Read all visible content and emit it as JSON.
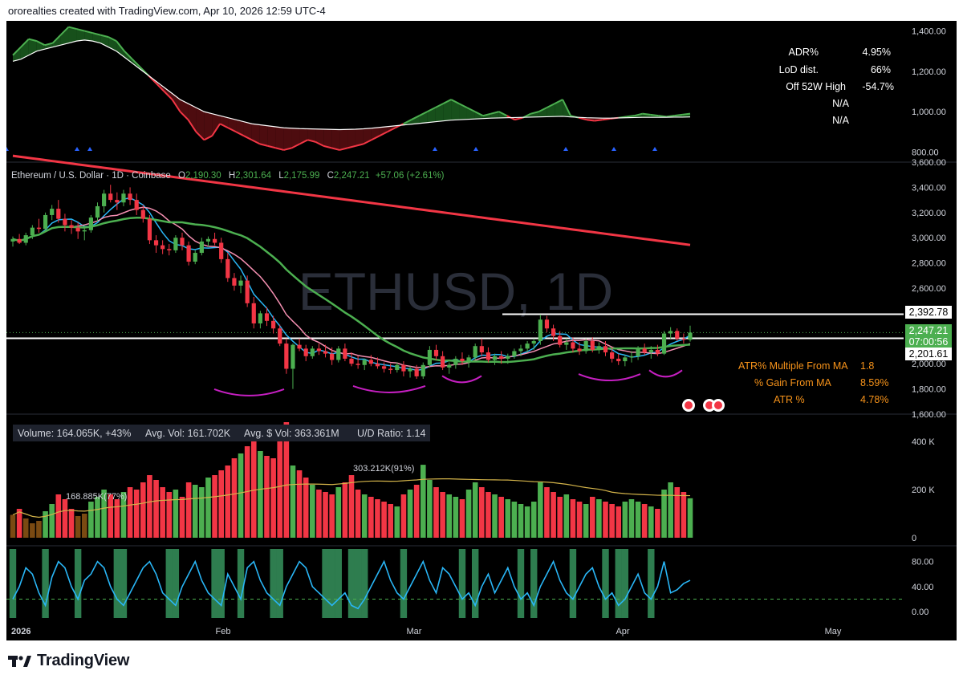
{
  "header": {
    "caption": "ororealties created with TradingView.com, Apr 10, 2026 12:59 UTC-4"
  },
  "branding": {
    "name": "TradingView",
    "icon": "tradingview-logo-icon"
  },
  "watermark": "ETHUSD, 1D",
  "colors": {
    "background": "#000000",
    "up": "#4caf50",
    "down": "#f23645",
    "ma_red": "#f23645",
    "ma_green": "#4caf50",
    "ma_pink": "#f48fb1",
    "ma_cyan": "#29b6f6",
    "stats_orange": "#f7931a",
    "rsi_line": "#29b6f6",
    "volume_ma": "#d4b44a",
    "highlight_green": "#2e7d4f"
  },
  "top_panel": {
    "stats": [
      {
        "label": "ADR%",
        "value": "4.95%"
      },
      {
        "label": "LoD dist.",
        "value": "66%"
      },
      {
        "label": "Off 52W High",
        "value": "-54.7%"
      },
      {
        "label": "",
        "value": "N/A"
      },
      {
        "label": "",
        "value": "N/A"
      }
    ],
    "y_ticks": [
      "1,400.00",
      "1,200.00",
      "1,000.00",
      "800.00"
    ]
  },
  "legend": {
    "symbol": "Ethereum / U.S. Dollar · 1D · Coinbase",
    "o_label": "O",
    "o": "2,190.30",
    "h_label": "H",
    "h": "2,301.64",
    "l_label": "L",
    "l": "2,175.99",
    "c_label": "C",
    "c": "2,247.21",
    "change": "+57.06 (+2.61%)"
  },
  "price_panel": {
    "y_ticks": [
      "3,600.00",
      "3,400.00",
      "3,200.00",
      "3,000.00",
      "2,800.00",
      "2,600.00",
      "2,400.00",
      "2,200.00",
      "2,000.00",
      "1,800.00",
      "1,600.00"
    ],
    "levels": [
      {
        "label": "2,392.78",
        "value": 2392.78,
        "style": "white"
      },
      {
        "label": "2,247.21",
        "value": 2247.21,
        "style": "green"
      },
      {
        "label": "07:00:56",
        "value": 2247.21,
        "style": "green-sub"
      },
      {
        "label": "2,201.61",
        "value": 2201.61,
        "style": "white"
      }
    ],
    "stats": [
      {
        "label": "ATR% Multiple From MA",
        "value": "1.8"
      },
      {
        "label": "% Gain From MA",
        "value": "8.59%"
      },
      {
        "label": "ATR %",
        "value": "4.78%"
      }
    ]
  },
  "volume_panel": {
    "legend": {
      "volume": "Volume: 164.065K, +43%",
      "avg_vol": "Avg. Vol: 161.702K",
      "dollar_vol": "Avg. $ Vol: 363.361M",
      "ud_ratio": "U/D Ratio: 1.14"
    },
    "y_ticks": [
      "400 K",
      "200 K",
      "0"
    ],
    "annotations": [
      {
        "text": "168.885K(77%)"
      },
      {
        "text": "303.212K(91%)"
      }
    ]
  },
  "osc_panel": {
    "y_ticks": [
      "80.00",
      "40.00",
      "0.00"
    ]
  },
  "x_axis": {
    "labels": [
      "2026",
      "Feb",
      "Mar",
      "Apr",
      "May"
    ]
  },
  "chart_data": {
    "type": "candlestick",
    "symbol": "ETHUSD",
    "interval": "1D",
    "x": [
      "2026",
      "Feb",
      "Mar",
      "Apr",
      "May"
    ],
    "price_ylim": [
      1600,
      3600
    ],
    "volume_ylim": [
      0,
      480000
    ],
    "osc_ylim": [
      -10,
      100
    ],
    "top_ylim": [
      750,
      1450
    ],
    "candles": [
      [
        2970,
        3010,
        2930,
        2990
      ],
      [
        2990,
        3030,
        2950,
        2960
      ],
      [
        2960,
        3040,
        2940,
        3020
      ],
      [
        3020,
        3100,
        2990,
        3080
      ],
      [
        3080,
        3150,
        3040,
        3070
      ],
      [
        3070,
        3200,
        3050,
        3180
      ],
      [
        3180,
        3260,
        3140,
        3230
      ],
      [
        3230,
        3300,
        3120,
        3150
      ],
      [
        3150,
        3190,
        3050,
        3100
      ],
      [
        3100,
        3140,
        3030,
        3080
      ],
      [
        3080,
        3120,
        2990,
        3050
      ],
      [
        3050,
        3100,
        2980,
        3060
      ],
      [
        3060,
        3180,
        3040,
        3160
      ],
      [
        3160,
        3280,
        3130,
        3250
      ],
      [
        3250,
        3380,
        3200,
        3350
      ],
      [
        3350,
        3420,
        3280,
        3300
      ],
      [
        3300,
        3360,
        3220,
        3280
      ],
      [
        3280,
        3380,
        3250,
        3350
      ],
      [
        3350,
        3400,
        3260,
        3300
      ],
      [
        3300,
        3350,
        3180,
        3220
      ],
      [
        3220,
        3260,
        3120,
        3150
      ],
      [
        3150,
        3180,
        2950,
        2980
      ],
      [
        2980,
        3020,
        2880,
        2940
      ],
      [
        2940,
        2980,
        2870,
        2910
      ],
      [
        2910,
        2950,
        2860,
        2900
      ],
      [
        2900,
        3020,
        2880,
        3000
      ],
      [
        3000,
        3040,
        2900,
        2940
      ],
      [
        2940,
        2970,
        2780,
        2810
      ],
      [
        2810,
        2900,
        2790,
        2880
      ],
      [
        2880,
        3000,
        2860,
        2970
      ],
      [
        2970,
        3010,
        2930,
        2990
      ],
      [
        2990,
        3040,
        2940,
        2960
      ],
      [
        2960,
        3000,
        2800,
        2830
      ],
      [
        2830,
        2880,
        2650,
        2680
      ],
      [
        2680,
        2720,
        2580,
        2620
      ],
      [
        2620,
        2700,
        2560,
        2660
      ],
      [
        2660,
        2700,
        2450,
        2480
      ],
      [
        2480,
        2530,
        2280,
        2320
      ],
      [
        2320,
        2420,
        2280,
        2400
      ],
      [
        2400,
        2450,
        2300,
        2340
      ],
      [
        2340,
        2380,
        2240,
        2280
      ],
      [
        2280,
        2310,
        2140,
        2160
      ],
      [
        2160,
        2200,
        1920,
        1960
      ],
      [
        1960,
        2160,
        1800,
        2150
      ],
      [
        2150,
        2200,
        2100,
        2120
      ],
      [
        2120,
        2150,
        2020,
        2060
      ],
      [
        2060,
        2140,
        2040,
        2120
      ],
      [
        2120,
        2160,
        2070,
        2100
      ],
      [
        2100,
        2150,
        2050,
        2080
      ],
      [
        2080,
        2130,
        1990,
        2030
      ],
      [
        2030,
        2140,
        2010,
        2120
      ],
      [
        2120,
        2160,
        2020,
        2040
      ],
      [
        2040,
        2090,
        1980,
        2000
      ],
      [
        2000,
        2060,
        1960,
        1990
      ],
      [
        1990,
        2040,
        1950,
        2030
      ],
      [
        2030,
        2070,
        1980,
        2000
      ],
      [
        2000,
        2050,
        1960,
        1980
      ],
      [
        1980,
        2010,
        1930,
        1960
      ],
      [
        1960,
        2000,
        1920,
        1950
      ],
      [
        1950,
        2010,
        1930,
        1990
      ],
      [
        1990,
        2020,
        1900,
        1940
      ],
      [
        1940,
        1980,
        1890,
        1960
      ],
      [
        1960,
        1990,
        1880,
        1900
      ],
      [
        1900,
        2010,
        1880,
        1990
      ],
      [
        1990,
        2140,
        1970,
        2110
      ],
      [
        2110,
        2150,
        2030,
        2060
      ],
      [
        2060,
        2100,
        1950,
        1970
      ],
      [
        1970,
        2010,
        1920,
        1990
      ],
      [
        1990,
        2060,
        1960,
        2040
      ],
      [
        2040,
        2090,
        1990,
        2020
      ],
      [
        2020,
        2070,
        1970,
        2050
      ],
      [
        2050,
        2160,
        2030,
        2140
      ],
      [
        2140,
        2200,
        2060,
        2090
      ],
      [
        2090,
        2130,
        2010,
        2030
      ],
      [
        2030,
        2080,
        1990,
        2060
      ],
      [
        2060,
        2100,
        2000,
        2040
      ],
      [
        2040,
        2080,
        2000,
        2060
      ],
      [
        2060,
        2120,
        2040,
        2100
      ],
      [
        2100,
        2150,
        2060,
        2120
      ],
      [
        2120,
        2180,
        2090,
        2160
      ],
      [
        2160,
        2200,
        2110,
        2180
      ],
      [
        2180,
        2390,
        2150,
        2350
      ],
      [
        2350,
        2380,
        2250,
        2280
      ],
      [
        2280,
        2310,
        2180,
        2220
      ],
      [
        2220,
        2260,
        2130,
        2150
      ],
      [
        2150,
        2200,
        2110,
        2170
      ],
      [
        2170,
        2210,
        2090,
        2120
      ],
      [
        2120,
        2170,
        2070,
        2100
      ],
      [
        2100,
        2200,
        2080,
        2180
      ],
      [
        2180,
        2210,
        2090,
        2110
      ],
      [
        2110,
        2170,
        2080,
        2140
      ],
      [
        2140,
        2180,
        2060,
        2090
      ],
      [
        2090,
        2130,
        2010,
        2040
      ],
      [
        2040,
        2080,
        1990,
        2020
      ],
      [
        2020,
        2070,
        1980,
        2050
      ],
      [
        2050,
        2100,
        2010,
        2060
      ],
      [
        2060,
        2140,
        2030,
        2120
      ],
      [
        2120,
        2160,
        2070,
        2090
      ],
      [
        2090,
        2140,
        2040,
        2110
      ],
      [
        2110,
        2150,
        2060,
        2080
      ],
      [
        2080,
        2260,
        2070,
        2240
      ],
      [
        2240,
        2290,
        2200,
        2260
      ],
      [
        2260,
        2280,
        2180,
        2200
      ],
      [
        2200,
        2240,
        2160,
        2190
      ],
      [
        2190,
        2302,
        2176,
        2247
      ]
    ],
    "volume": [
      95,
      120,
      80,
      60,
      70,
      110,
      140,
      180,
      160,
      120,
      90,
      100,
      150,
      170,
      200,
      180,
      160,
      190,
      210,
      200,
      230,
      260,
      240,
      210,
      190,
      200,
      170,
      230,
      220,
      210,
      250,
      260,
      280,
      300,
      330,
      350,
      380,
      400,
      360,
      340,
      330,
      420,
      480,
      300,
      280,
      250,
      220,
      200,
      190,
      180,
      210,
      230,
      260,
      200,
      180,
      170,
      160,
      150,
      140,
      130,
      180,
      200,
      220,
      303,
      240,
      210,
      190,
      180,
      170,
      160,
      200,
      230,
      210,
      190,
      180,
      170,
      160,
      150,
      140,
      130,
      150,
      230,
      210,
      190,
      170,
      180,
      160,
      150,
      140,
      170,
      160,
      150,
      140,
      130,
      150,
      160,
      150,
      140,
      130,
      120,
      200,
      230,
      210,
      190,
      164
    ],
    "volume_colors": "up/down per candle",
    "osc": [
      20,
      40,
      70,
      60,
      30,
      10,
      55,
      80,
      70,
      40,
      20,
      50,
      60,
      80,
      70,
      40,
      20,
      10,
      30,
      50,
      70,
      80,
      60,
      30,
      20,
      10,
      40,
      60,
      80,
      50,
      30,
      20,
      10,
      60,
      40,
      20,
      70,
      80,
      50,
      30,
      20,
      10,
      40,
      60,
      80,
      70,
      40,
      30,
      20,
      10,
      20,
      30,
      10,
      5,
      20,
      40,
      60,
      80,
      50,
      30,
      20,
      40,
      60,
      80,
      50,
      30,
      70,
      60,
      40,
      20,
      30,
      10,
      40,
      60,
      30,
      50,
      70,
      40,
      20,
      30,
      10,
      40,
      60,
      80,
      50,
      30,
      20,
      40,
      60,
      70,
      40,
      20,
      30,
      10,
      20,
      40,
      60,
      30,
      20,
      40,
      80,
      30,
      35,
      45,
      50
    ],
    "top_line": [
      1280,
      1320,
      1360,
      1350,
      1330,
      1340,
      1380,
      1420,
      1410,
      1400,
      1390,
      1380,
      1370,
      1350,
      1300,
      1260,
      1220,
      1180,
      1140,
      1100,
      1060,
      1000,
      960,
      900,
      860,
      880,
      940,
      920,
      900,
      880,
      860,
      840,
      830,
      820,
      810,
      820,
      840,
      860,
      850,
      830,
      820,
      810,
      820,
      830,
      840,
      860,
      880,
      900,
      920,
      940,
      960,
      980,
      1000,
      1020,
      1040,
      1060,
      1040,
      1020,
      1000,
      980,
      990,
      1000,
      980,
      960,
      970,
      990,
      1000,
      1020,
      1040,
      1060,
      980,
      970,
      960,
      955,
      960,
      965,
      970,
      975,
      980,
      990,
      985,
      980,
      975,
      980,
      985,
      990
    ],
    "top_ma": [
      1250,
      1260,
      1280,
      1300,
      1310,
      1320,
      1330,
      1340,
      1350,
      1355,
      1350,
      1340,
      1320,
      1300,
      1270,
      1240,
      1210,
      1180,
      1150,
      1120,
      1090,
      1060,
      1040,
      1020,
      1000,
      990,
      980,
      970,
      960,
      950,
      940,
      935,
      930,
      925,
      920,
      918,
      916,
      915,
      914,
      913,
      912,
      911,
      912,
      913,
      915,
      918,
      922,
      926,
      930,
      934,
      938,
      942,
      946,
      950,
      954,
      958,
      960,
      962,
      964,
      966,
      968,
      969,
      970,
      971,
      972,
      973,
      974,
      975,
      976,
      977,
      974,
      972,
      970,
      969,
      968,
      968,
      969,
      970,
      971,
      972,
      972,
      972,
      972,
      973,
      973,
      974
    ]
  }
}
